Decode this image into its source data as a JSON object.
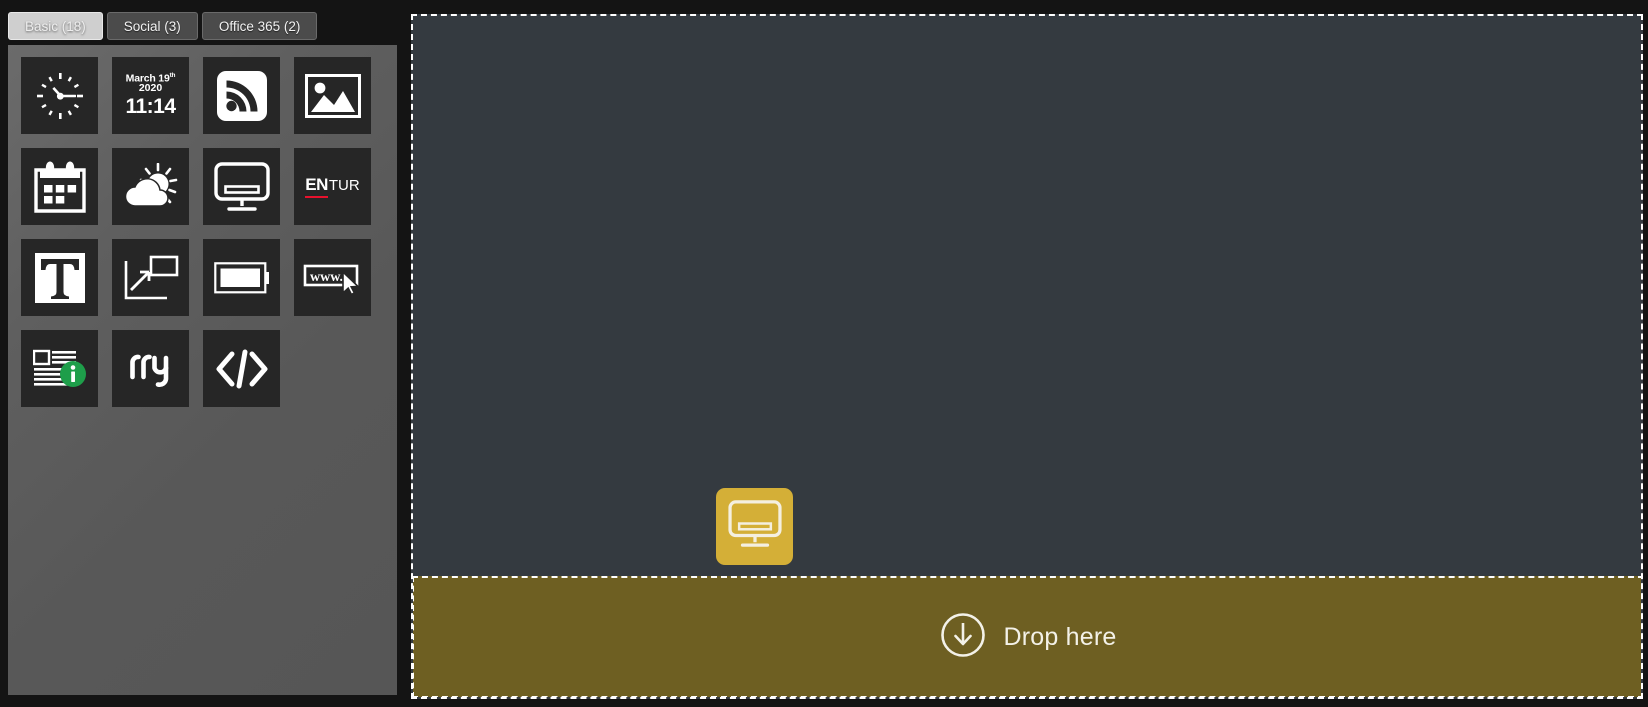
{
  "window": {
    "background_color": "#141414"
  },
  "left_panel": {
    "name": "widget-library",
    "background_gradient": [
      "#6b6b6b",
      "#565656"
    ],
    "tabs": [
      {
        "id": "basic",
        "label": "Basic (18)",
        "active": true
      },
      {
        "id": "social",
        "label": "Social (3)",
        "active": false
      },
      {
        "id": "office365",
        "label": "Office 365 (2)",
        "active": false
      }
    ],
    "tile_background": "#262626",
    "widgets": [
      {
        "id": "clock",
        "icon": "analog-clock-icon",
        "label": "Clock"
      },
      {
        "id": "date-time",
        "icon": "date-time-text-icon",
        "label": "Date and time",
        "date_month_day": "March 19",
        "date_ordinal": "th",
        "year": "2020",
        "time": "11:14"
      },
      {
        "id": "rss",
        "icon": "rss-feed-icon",
        "label": "RSS feed"
      },
      {
        "id": "image",
        "icon": "picture-image-icon",
        "label": "Image"
      },
      {
        "id": "calendar",
        "icon": "calendar-icon",
        "label": "Calendar"
      },
      {
        "id": "weather",
        "icon": "weather-sun-cloud-icon",
        "label": "Weather"
      },
      {
        "id": "display",
        "icon": "monitor-display-icon",
        "label": "Display"
      },
      {
        "id": "entur",
        "icon": "entur-logo-icon",
        "label": "Entur",
        "logo_bold": "EN",
        "logo_light": "TUR",
        "accent_color": "#e8112d"
      },
      {
        "id": "text",
        "icon": "text-t-icon",
        "label": "Text"
      },
      {
        "id": "scale",
        "icon": "scale-resize-icon",
        "label": "Scale"
      },
      {
        "id": "battery",
        "icon": "battery-icon",
        "label": "Battery"
      },
      {
        "id": "web",
        "icon": "web-url-cursor-icon",
        "label": "Web page",
        "url_text": "www."
      },
      {
        "id": "news-info",
        "icon": "news-info-icon",
        "label": "News",
        "badge_color": "#1e9e4a"
      },
      {
        "id": "fly",
        "icon": "fly-logo-icon",
        "label": "Fly"
      },
      {
        "id": "code",
        "icon": "code-brackets-icon",
        "label": "Custom code"
      }
    ]
  },
  "canvas": {
    "name": "layout-canvas",
    "background_color": "#343a40",
    "border_style": "dashed",
    "border_color": "#ffffff",
    "drag_ghost": {
      "icon": "monitor-display-icon",
      "background_color": "#d4af37",
      "widget_id": "display"
    }
  },
  "drop_zone": {
    "label": "Drop here",
    "icon": "arrow-down-circle-icon",
    "background_color": "#6e5f22",
    "border_color": "#ffffff",
    "text_color": "#f3f1e8"
  }
}
